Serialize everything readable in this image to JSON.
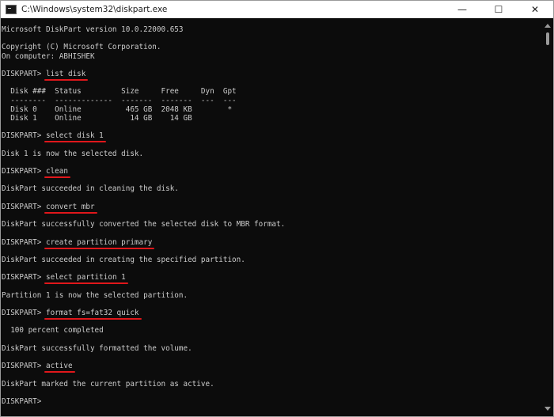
{
  "window": {
    "title": "C:\\Windows\\system32\\diskpart.exe",
    "minimize_glyph": "—",
    "maximize_glyph": "☐",
    "close_glyph": "✕"
  },
  "console": {
    "prompt": "DISKPART> ",
    "lines": [
      {
        "text": "Microsoft DiskPart version 10.0.22000.653"
      },
      {
        "text": ""
      },
      {
        "text": "Copyright (C) Microsoft Corporation."
      },
      {
        "text": "On computer: ABHISHEK"
      },
      {
        "text": ""
      },
      {
        "cmd": "list disk"
      },
      {
        "text": ""
      },
      {
        "text": "  Disk ###  Status         Size     Free     Dyn  Gpt"
      },
      {
        "text": "  --------  -------------  -------  -------  ---  ---"
      },
      {
        "text": "  Disk 0    Online          465 GB  2048 KB        *"
      },
      {
        "text": "  Disk 1    Online           14 GB    14 GB"
      },
      {
        "text": ""
      },
      {
        "cmd": "select disk 1"
      },
      {
        "text": ""
      },
      {
        "text": "Disk 1 is now the selected disk."
      },
      {
        "text": ""
      },
      {
        "cmd": "clean"
      },
      {
        "text": ""
      },
      {
        "text": "DiskPart succeeded in cleaning the disk."
      },
      {
        "text": ""
      },
      {
        "cmd": "convert mbr"
      },
      {
        "text": ""
      },
      {
        "text": "DiskPart successfully converted the selected disk to MBR format."
      },
      {
        "text": ""
      },
      {
        "cmd": "create partition primary"
      },
      {
        "text": ""
      },
      {
        "text": "DiskPart succeeded in creating the specified partition."
      },
      {
        "text": ""
      },
      {
        "cmd": "select partition 1"
      },
      {
        "text": ""
      },
      {
        "text": "Partition 1 is now the selected partition."
      },
      {
        "text": ""
      },
      {
        "cmd": "format fs=fat32 quick"
      },
      {
        "text": ""
      },
      {
        "text": "  100 percent completed"
      },
      {
        "text": ""
      },
      {
        "text": "DiskPart successfully formatted the volume."
      },
      {
        "text": ""
      },
      {
        "cmd": "active"
      },
      {
        "text": ""
      },
      {
        "text": "DiskPart marked the current partition as active."
      },
      {
        "text": ""
      },
      {
        "cmd": ""
      }
    ]
  },
  "colors": {
    "console_background": "#0c0c0c",
    "console_text": "#cccccc",
    "command_underline": "#e0171b"
  }
}
